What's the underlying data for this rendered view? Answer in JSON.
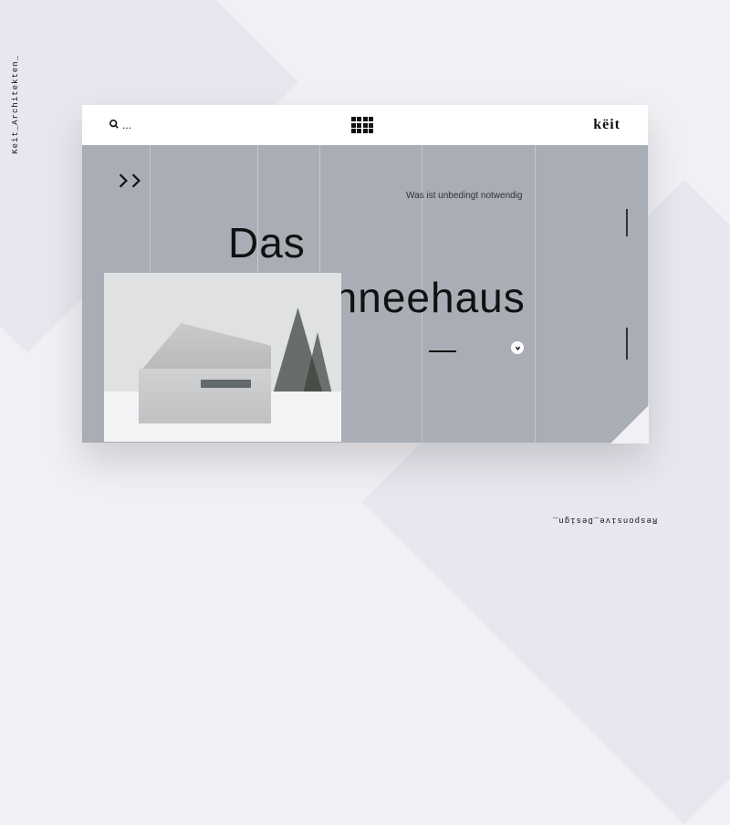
{
  "side_labels": {
    "left": "Keit_Architekten_",
    "bottom": "Responsive_Design_"
  },
  "topbar": {
    "search_placeholder": "...",
    "logo": "këit"
  },
  "hero": {
    "tagline": "Was ist unbedingt notwendig",
    "title_line1": "Das",
    "title_line2": "Schneehaus"
  }
}
